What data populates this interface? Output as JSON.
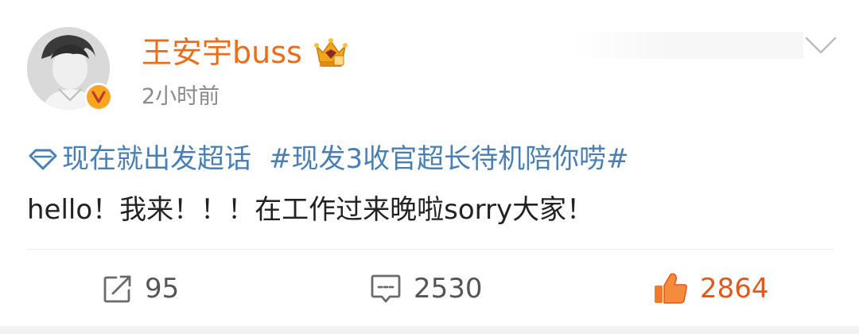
{
  "post": {
    "username": "王安宇buss",
    "time": "2小时前",
    "topic": "现在就出发超话",
    "hashtag": "#现发3收官超长待机陪你唠#",
    "body": "hello！我来！！！在工作过来晚啦sorry大家！"
  },
  "actions": {
    "repost_count": "95",
    "comment_count": "2530",
    "like_count": "2864"
  },
  "icons": {
    "avatar": "profile-photo",
    "verified": "verified-v-badge",
    "crown": "crown-vip-icon",
    "more": "chevron-down-icon",
    "supertopic": "diamond-supertopic-icon",
    "repost": "share-arrow-icon",
    "comment": "comment-bubble-icon",
    "like": "thumbs-up-icon"
  },
  "colors": {
    "username": "#ea6d1b",
    "link": "#4a7fb3",
    "like_active": "#e4571a",
    "verified": "#f6a623"
  }
}
